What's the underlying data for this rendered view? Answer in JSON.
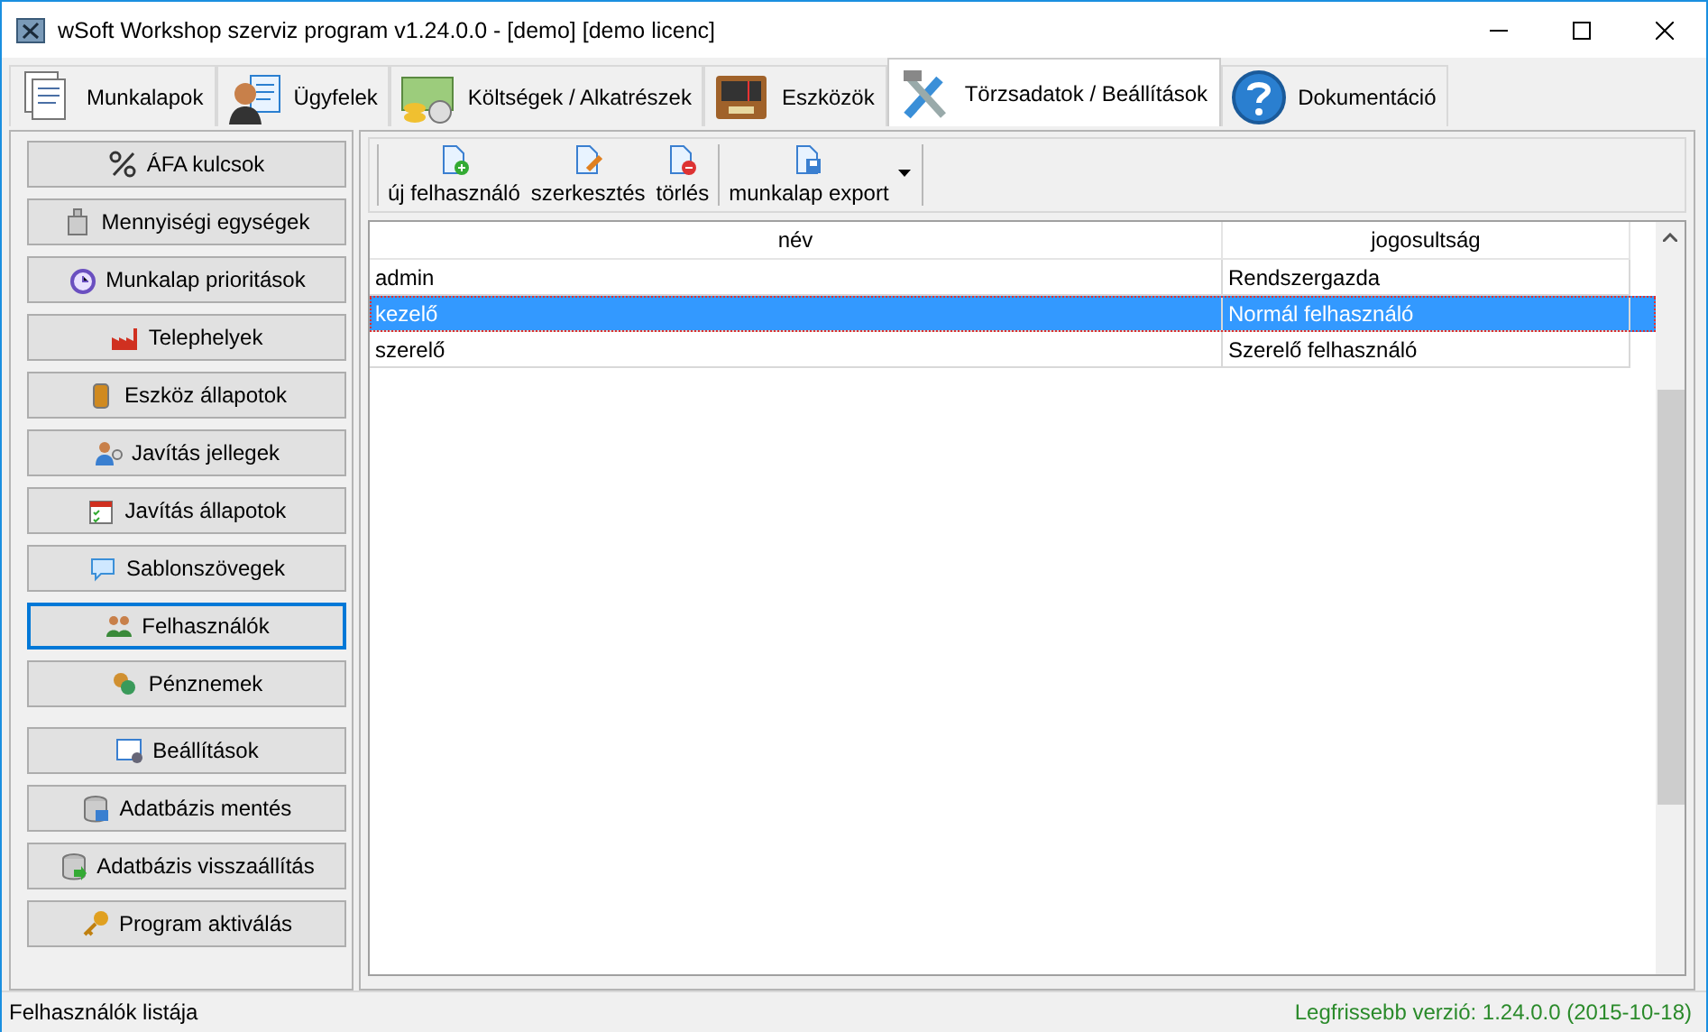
{
  "window": {
    "title": "wSoft Workshop szerviz program v1.24.0.0 - [demo] [demo licenc]"
  },
  "tabs": [
    {
      "label": "Munkalapok",
      "selected": false
    },
    {
      "label": "Ügyfelek",
      "selected": false
    },
    {
      "label": "Költségek / Alkatrészek",
      "selected": false
    },
    {
      "label": "Eszközök",
      "selected": false
    },
    {
      "label": "Törzsadatok / Beállítások",
      "selected": true
    },
    {
      "label": "Dokumentáció",
      "selected": false
    }
  ],
  "sidebar": {
    "groups": [
      {
        "items": [
          {
            "label": "ÁFA kulcsok",
            "selected": false
          },
          {
            "label": "Mennyiségi egységek",
            "selected": false
          },
          {
            "label": "Munkalap prioritások",
            "selected": false
          },
          {
            "label": "Telephelyek",
            "selected": false
          },
          {
            "label": "Eszköz állapotok",
            "selected": false
          },
          {
            "label": "Javítás jellegek",
            "selected": false
          },
          {
            "label": "Javítás állapotok",
            "selected": false
          },
          {
            "label": "Sablonszövegek",
            "selected": false
          },
          {
            "label": "Felhasználók",
            "selected": true
          },
          {
            "label": "Pénznemek",
            "selected": false
          }
        ]
      },
      {
        "items": [
          {
            "label": "Beállítások",
            "selected": false
          },
          {
            "label": "Adatbázis mentés",
            "selected": false
          },
          {
            "label": "Adatbázis visszaállítás",
            "selected": false
          },
          {
            "label": "Program aktiválás",
            "selected": false
          }
        ]
      }
    ]
  },
  "toolbar": [
    {
      "label": "új felhasználó",
      "kind": "button"
    },
    {
      "label": "szerkesztés",
      "kind": "button"
    },
    {
      "label": "törlés",
      "kind": "button"
    },
    {
      "label": "munkalap export",
      "kind": "dropdown"
    }
  ],
  "table": {
    "columns": [
      "név",
      "jogosultság"
    ],
    "rows": [
      {
        "cells": [
          "admin",
          "Rendszergazda"
        ],
        "selected": false
      },
      {
        "cells": [
          "kezelő",
          "Normál felhasználó"
        ],
        "selected": true
      },
      {
        "cells": [
          "szerelő",
          "Szerelő felhasználó"
        ],
        "selected": false
      }
    ]
  },
  "status_bar": {
    "left": "Felhasználók listája",
    "right": "Legfrissebb verzió: 1.24.0.0 (2015-10-18)"
  }
}
